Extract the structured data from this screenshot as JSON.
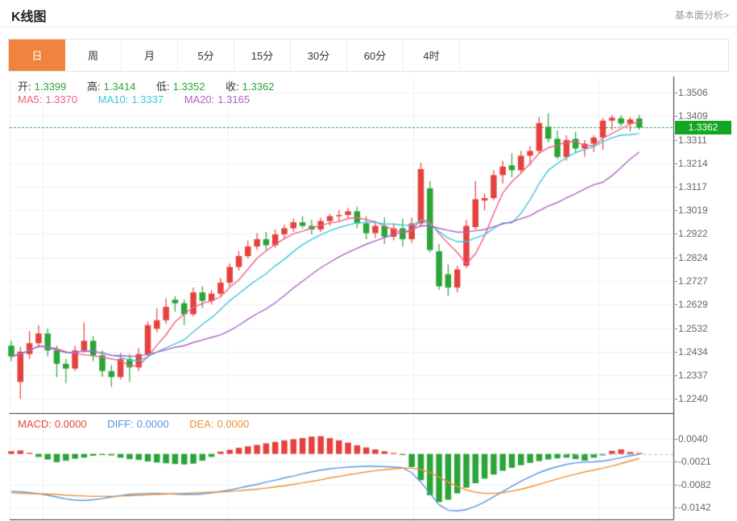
{
  "header": {
    "title": "K线图",
    "link_label": "基本面分析>"
  },
  "tabs": {
    "items": [
      "日",
      "周",
      "月",
      "5分",
      "15分",
      "30分",
      "60分",
      "4时"
    ],
    "selected": "日",
    "selected_index": 0
  },
  "ohlc": {
    "open_label": "开:",
    "open": "1.3399",
    "high_label": "高:",
    "high": "1.3414",
    "low_label": "低:",
    "low": "1.3352",
    "close_label": "收:",
    "close": "1.3362"
  },
  "ma": {
    "ma5_label": "MA5:",
    "ma5": "1.3370",
    "ma10_label": "MA10:",
    "ma10": "1.3337",
    "ma20_label": "MA20:",
    "ma20": "1.3165"
  },
  "macd_info": {
    "macd_label": "MACD:",
    "macd": "0.0000",
    "diff_label": "DIFF:",
    "diff": "0.0000",
    "dea_label": "DEA:",
    "dea": "0.0000"
  },
  "price_tag": "1.3362",
  "colors": {
    "up_red": "#e5413e",
    "down_green": "#2ba438",
    "badge_green": "#12a722",
    "dotted_green": "#2ba438",
    "ma5_pink": "#f0607f",
    "ma10_cyan": "#3fc3de",
    "ma20_purple": "#ae62c4",
    "diff_blue": "#5596e0",
    "dea_orange": "#ee8f33",
    "tab_active_orange": "#f0833d",
    "grid_gray": "#eef0f3",
    "axis_dark": "#2e2e2e",
    "axis_text_gray": "#666666",
    "macd_zero_dash_blue": "#a5c9e8"
  },
  "chart_data": {
    "type": "candlestick",
    "title": "K线图",
    "legend": [
      "MA5",
      "MA10",
      "MA20",
      "MACD",
      "DIFF",
      "DEA"
    ],
    "grid": true,
    "main": {
      "ylim": [
        1.224,
        1.3506
      ],
      "axis_labels": [
        "1.3506",
        "1.3409",
        "1.3311",
        "1.3214",
        "1.3117",
        "1.3019",
        "1.2922",
        "1.2824",
        "1.2727",
        "1.2629",
        "1.2532",
        "1.2434",
        "1.2337",
        "1.2240"
      ],
      "last_price": 1.3362,
      "ma_periods": [
        5,
        10,
        20
      ],
      "candles_ohlc": [
        [
          1.246,
          1.248,
          1.2395,
          1.2415
        ],
        [
          1.231,
          1.2455,
          1.224,
          1.2435
        ],
        [
          1.2425,
          1.252,
          1.2405,
          1.247
        ],
        [
          1.247,
          1.2545,
          1.245,
          1.251
        ],
        [
          1.251,
          1.253,
          1.2415,
          1.244
        ],
        [
          1.244,
          1.246,
          1.233,
          1.2385
        ],
        [
          1.2385,
          1.2405,
          1.2305,
          1.2365
        ],
        [
          1.2365,
          1.246,
          1.2355,
          1.244
        ],
        [
          1.244,
          1.2555,
          1.243,
          1.248
        ],
        [
          1.248,
          1.25,
          1.2395,
          1.242
        ],
        [
          1.242,
          1.244,
          1.233,
          1.2355
        ],
        [
          1.2355,
          1.238,
          1.229,
          1.233
        ],
        [
          1.233,
          1.243,
          1.232,
          1.2405
        ],
        [
          1.2405,
          1.2425,
          1.231,
          1.237
        ],
        [
          1.237,
          1.245,
          1.2355,
          1.2425
        ],
        [
          1.2425,
          1.256,
          1.241,
          1.2545
        ],
        [
          1.253,
          1.2615,
          1.2515,
          1.2565
        ],
        [
          1.2565,
          1.2655,
          1.255,
          1.262
        ],
        [
          1.265,
          1.2665,
          1.26,
          1.2635
        ],
        [
          1.2635,
          1.265,
          1.2545,
          1.259
        ],
        [
          1.259,
          1.27,
          1.258,
          1.268
        ],
        [
          1.268,
          1.2705,
          1.2615,
          1.2645
        ],
        [
          1.2645,
          1.269,
          1.263,
          1.2675
        ],
        [
          1.2675,
          1.274,
          1.266,
          1.272
        ],
        [
          1.272,
          1.28,
          1.2705,
          1.2785
        ],
        [
          1.2785,
          1.285,
          1.277,
          1.283
        ],
        [
          1.283,
          1.2895,
          1.282,
          1.287
        ],
        [
          1.287,
          1.2925,
          1.2855,
          1.29
        ],
        [
          1.29,
          1.293,
          1.2855,
          1.2875
        ],
        [
          1.2875,
          1.294,
          1.2865,
          1.292
        ],
        [
          1.292,
          1.296,
          1.29,
          1.2945
        ],
        [
          1.2945,
          1.2985,
          1.293,
          1.297
        ],
        [
          1.297,
          1.2995,
          1.2945,
          1.2955
        ],
        [
          1.2955,
          1.298,
          1.292,
          1.294
        ],
        [
          1.294,
          1.299,
          1.293,
          1.2975
        ],
        [
          1.2975,
          1.3005,
          1.2955,
          1.2995
        ],
        [
          1.2995,
          1.302,
          1.297,
          1.3
        ],
        [
          1.3,
          1.303,
          1.2985,
          1.3015
        ],
        [
          1.3015,
          1.3035,
          1.2945,
          1.2965
        ],
        [
          1.2965,
          1.2995,
          1.29,
          1.2925
        ],
        [
          1.2925,
          1.2975,
          1.2905,
          1.2955
        ],
        [
          1.2955,
          1.299,
          1.288,
          1.291
        ],
        [
          1.291,
          1.2965,
          1.2895,
          1.2945
        ],
        [
          1.2945,
          1.2985,
          1.287,
          1.29
        ],
        [
          1.29,
          1.299,
          1.2885,
          1.2965
        ],
        [
          1.2965,
          1.3215,
          1.295,
          1.319
        ],
        [
          1.311,
          1.314,
          1.2845,
          1.2855
        ],
        [
          1.285,
          1.288,
          1.269,
          1.2705
        ],
        [
          1.2755,
          1.2795,
          1.2665,
          1.27
        ],
        [
          1.27,
          1.279,
          1.268,
          1.2775
        ],
        [
          1.279,
          1.298,
          1.278,
          1.2955
        ],
        [
          1.295,
          1.314,
          1.294,
          1.3065
        ],
        [
          1.306,
          1.309,
          1.302,
          1.307
        ],
        [
          1.307,
          1.3185,
          1.306,
          1.3165
        ],
        [
          1.3165,
          1.3225,
          1.313,
          1.32
        ],
        [
          1.3205,
          1.3255,
          1.3155,
          1.3185
        ],
        [
          1.3185,
          1.3265,
          1.3175,
          1.3245
        ],
        [
          1.3245,
          1.3285,
          1.3205,
          1.3265
        ],
        [
          1.3265,
          1.3405,
          1.3255,
          1.338
        ],
        [
          1.3365,
          1.342,
          1.33,
          1.3315
        ],
        [
          1.3315,
          1.335,
          1.323,
          1.324
        ],
        [
          1.324,
          1.333,
          1.3225,
          1.331
        ],
        [
          1.3315,
          1.3345,
          1.3255,
          1.3275
        ],
        [
          1.3275,
          1.331,
          1.324,
          1.3295
        ],
        [
          1.3295,
          1.333,
          1.326,
          1.332
        ],
        [
          1.332,
          1.34,
          1.327,
          1.339
        ],
        [
          1.339,
          1.3413,
          1.335,
          1.3402
        ],
        [
          1.34,
          1.3414,
          1.3365,
          1.3378
        ],
        [
          1.3378,
          1.3405,
          1.3345,
          1.3395
        ],
        [
          1.3399,
          1.3414,
          1.3352,
          1.3362
        ]
      ]
    },
    "macd": {
      "axis_labels": [
        "0.0040",
        "-0.0021",
        "-0.0082",
        "-0.0142"
      ],
      "hist": [
        0.0007,
        0.0009,
        0.0003,
        -0.0008,
        -0.0015,
        -0.0022,
        -0.0018,
        -0.0013,
        -0.001,
        -0.0005,
        -0.0003,
        -0.0004,
        -0.001,
        -0.0014,
        -0.0016,
        -0.002,
        -0.0023,
        -0.0025,
        -0.0027,
        -0.0028,
        -0.0026,
        -0.0018,
        -0.0008,
        0.0006,
        0.0011,
        0.0016,
        0.002,
        0.0024,
        0.0028,
        0.0032,
        0.0036,
        0.0039,
        0.0042,
        0.0046,
        0.0047,
        0.0042,
        0.0036,
        0.003,
        0.0023,
        0.0017,
        0.0012,
        0.0007,
        0.0002,
        -0.0003,
        -0.0035,
        -0.007,
        -0.011,
        -0.0128,
        -0.0122,
        -0.0105,
        -0.009,
        -0.0078,
        -0.0066,
        -0.0055,
        -0.0045,
        -0.0037,
        -0.003,
        -0.0024,
        -0.0019,
        -0.0015,
        -0.0012,
        -0.001,
        -0.0014,
        -0.0018,
        -0.001,
        -0.0004,
        0.0008,
        0.0012,
        0.0005,
        0.0001
      ],
      "diff": [
        -0.01,
        -0.0101,
        -0.0103,
        -0.0106,
        -0.011,
        -0.0115,
        -0.012,
        -0.0123,
        -0.0124,
        -0.0122,
        -0.0119,
        -0.0115,
        -0.0111,
        -0.0108,
        -0.0106,
        -0.0105,
        -0.0105,
        -0.0106,
        -0.0107,
        -0.0108,
        -0.0108,
        -0.0107,
        -0.0104,
        -0.01,
        -0.0096,
        -0.0091,
        -0.0086,
        -0.0081,
        -0.0075,
        -0.007,
        -0.0064,
        -0.0059,
        -0.0053,
        -0.0048,
        -0.0043,
        -0.004,
        -0.0037,
        -0.0035,
        -0.0034,
        -0.0033,
        -0.0033,
        -0.0034,
        -0.0035,
        -0.0037,
        -0.005,
        -0.0075,
        -0.0105,
        -0.0135,
        -0.015,
        -0.0152,
        -0.0148,
        -0.014,
        -0.0128,
        -0.0114,
        -0.01,
        -0.0086,
        -0.0073,
        -0.0061,
        -0.005,
        -0.0041,
        -0.0034,
        -0.0028,
        -0.0024,
        -0.0022,
        -0.0021,
        -0.0019,
        -0.0015,
        -0.001,
        -0.0005,
        -0.0001
      ],
      "dea": [
        -0.0104,
        -0.0105,
        -0.0106,
        -0.0106,
        -0.0107,
        -0.0108,
        -0.011,
        -0.0111,
        -0.0112,
        -0.0113,
        -0.0113,
        -0.0113,
        -0.0112,
        -0.0111,
        -0.011,
        -0.0109,
        -0.0108,
        -0.0107,
        -0.0106,
        -0.0105,
        -0.0104,
        -0.0103,
        -0.0102,
        -0.0101,
        -0.01,
        -0.0098,
        -0.0096,
        -0.0094,
        -0.0091,
        -0.0088,
        -0.0085,
        -0.0081,
        -0.0077,
        -0.0073,
        -0.0069,
        -0.0064,
        -0.006,
        -0.0056,
        -0.0052,
        -0.0048,
        -0.0045,
        -0.0042,
        -0.004,
        -0.0038,
        -0.0038,
        -0.0042,
        -0.005,
        -0.0062,
        -0.0075,
        -0.0087,
        -0.0096,
        -0.0102,
        -0.0105,
        -0.0105,
        -0.0103,
        -0.0099,
        -0.0094,
        -0.0088,
        -0.0081,
        -0.0074,
        -0.0067,
        -0.006,
        -0.0054,
        -0.0048,
        -0.0043,
        -0.0038,
        -0.0032,
        -0.0026,
        -0.0019,
        -0.0012
      ]
    }
  }
}
